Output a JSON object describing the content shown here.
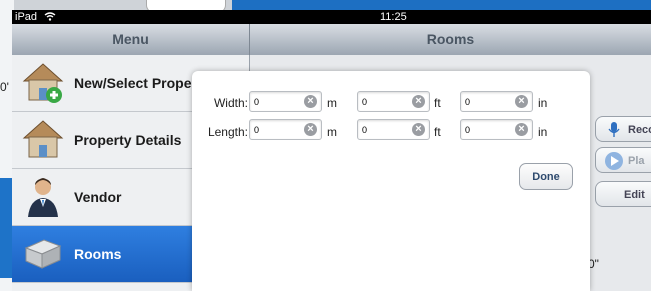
{
  "status_bar": {
    "device": "iPad",
    "time": "11:25"
  },
  "background": {
    "left_value": "0'",
    "bottom_value": "0\""
  },
  "menu": {
    "title": "Menu",
    "items": [
      {
        "label": "New/Select Prope",
        "icon": "house-add-icon"
      },
      {
        "label": "Property Details",
        "icon": "house-icon"
      },
      {
        "label": "Vendor",
        "icon": "person-icon"
      },
      {
        "label": "Rooms",
        "icon": "room-cube-icon"
      }
    ]
  },
  "rooms_pane": {
    "title": "Rooms",
    "buttons": {
      "record": "Reco",
      "play": "Pla",
      "edit": "Edit"
    }
  },
  "dimension_dialog": {
    "rows": [
      {
        "label": "Width:",
        "m": "0",
        "ft": "0",
        "in": "0"
      },
      {
        "label": "Length:",
        "m": "0",
        "ft": "0",
        "in": "0"
      }
    ],
    "units": {
      "m": "m",
      "ft": "ft",
      "in": "in"
    },
    "done": "Done"
  },
  "colors": {
    "accent": "#1a5fbf",
    "statusbar": "#000000",
    "header": "#9ca6b2"
  }
}
